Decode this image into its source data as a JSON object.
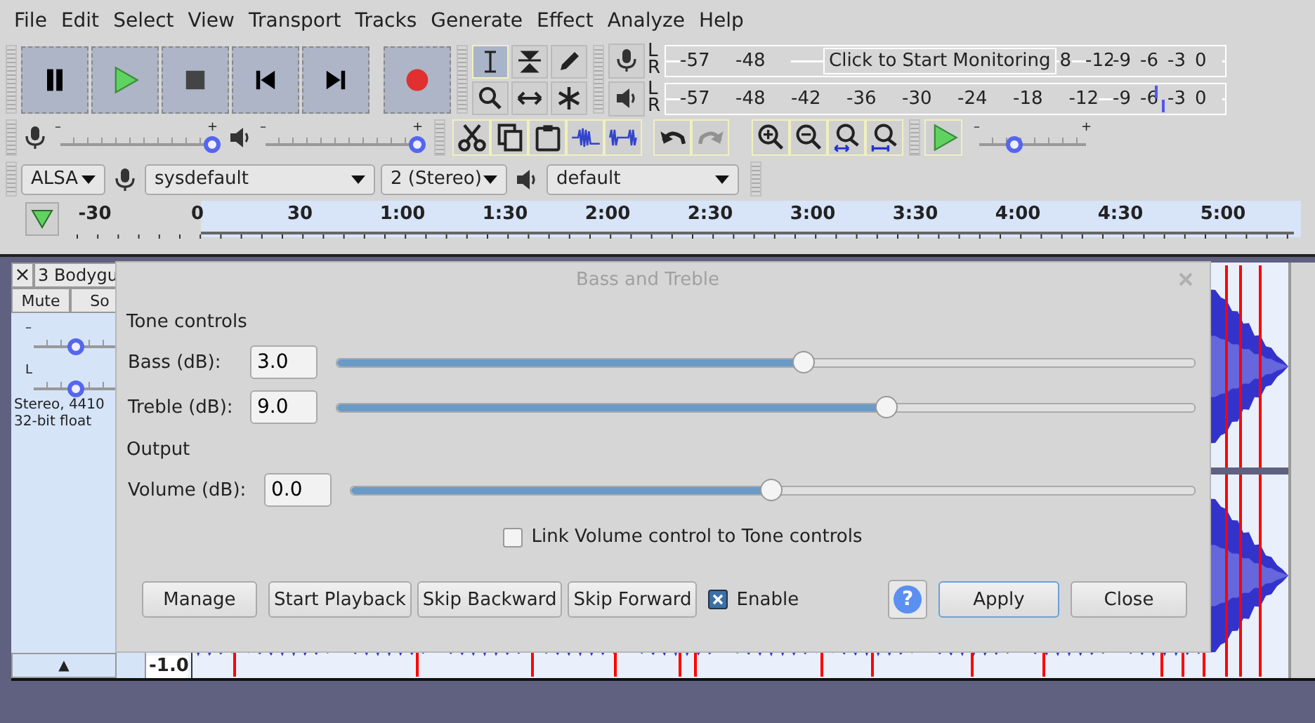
{
  "menu": [
    "File",
    "Edit",
    "Select",
    "View",
    "Transport",
    "Tracks",
    "Generate",
    "Effect",
    "Analyze",
    "Help"
  ],
  "transport": [
    {
      "kind": "pause"
    },
    {
      "kind": "play"
    },
    {
      "kind": "stop"
    },
    {
      "kind": "skip-start"
    },
    {
      "kind": "skip-end"
    },
    {
      "kind": "record"
    }
  ],
  "tools": [
    {
      "kind": "ibeam",
      "selected": true
    },
    {
      "kind": "envelope",
      "selected": false
    },
    {
      "kind": "pencil",
      "selected": false
    },
    {
      "kind": "zoom",
      "selected": false
    },
    {
      "kind": "timeshift",
      "selected": false
    },
    {
      "kind": "multi",
      "selected": false
    }
  ],
  "meters": [
    {
      "kind": "record",
      "channels": [
        "L",
        "R"
      ],
      "scale_low": [
        "-57",
        "-48"
      ],
      "scale_high": [
        "8",
        "-12",
        "-9",
        "-6",
        "-3",
        "0"
      ],
      "tooltip": "Click to Start Monitoring"
    },
    {
      "kind": "playback",
      "channels": [
        "L",
        "R"
      ],
      "scale_low": [
        "-57",
        "-48",
        "-42",
        "-36",
        "-30",
        "-24",
        "-18"
      ],
      "scale_high": [
        "-12",
        "-9",
        "-6",
        "-3",
        "0"
      ],
      "peaks": [
        {
          "level": 0.875
        },
        {
          "level": 0.888
        }
      ]
    }
  ],
  "mixer": [
    {
      "kind": "record",
      "minus": "–",
      "plus": "+",
      "level": 1.0
    },
    {
      "kind": "playback",
      "minus": "–",
      "plus": "+",
      "level": 1.0
    }
  ],
  "edit_tools": [
    {
      "kind": "scissors"
    },
    {
      "kind": "copy"
    },
    {
      "kind": "paste"
    },
    {
      "kind": "trim"
    },
    {
      "kind": "silence"
    }
  ],
  "history": [
    {
      "kind": "undo",
      "disabled": false
    },
    {
      "kind": "redo",
      "disabled": true
    }
  ],
  "zoom_tools": [
    {
      "kind": "zoom-in"
    },
    {
      "kind": "zoom-out"
    },
    {
      "kind": "fit-selection"
    },
    {
      "kind": "fit-project"
    }
  ],
  "play_at_speed": {
    "minus": "–",
    "plus": "+",
    "level": 0.33
  },
  "devices": {
    "host": "ALSA",
    "input": "sysdefault",
    "channels": "2 (Stereo)",
    "output": "default"
  },
  "timeline": [
    "-30",
    "0",
    "30",
    "1:00",
    "1:30",
    "2:00",
    "2:30",
    "3:00",
    "3:30",
    "4:00",
    "4:30",
    "5:00"
  ],
  "track": {
    "close": "×",
    "name": "3 Bodygu",
    "buttons": [
      "Mute",
      "So"
    ],
    "slider_labels": [
      "–",
      "L"
    ],
    "info": [
      "Stereo, 4410",
      "32-bit float"
    ],
    "collapse": "▲",
    "scale": "-1.0"
  },
  "dialog": {
    "title": "Bass and Treble",
    "sections": [
      {
        "heading": "Tone controls",
        "rows": [
          {
            "label": "Bass (dB):",
            "value": "3.0",
            "level": 0.546
          },
          {
            "label": "Treble (dB):",
            "value": "9.0",
            "level": 0.644
          }
        ]
      },
      {
        "heading": "Output",
        "rows": [
          {
            "label": "Volume (dB):",
            "value": "0.0",
            "level": 0.498
          }
        ]
      }
    ],
    "link": {
      "label": "Link Volume control to Tone controls",
      "checked": false
    },
    "buttons": [
      "Manage",
      "Start Playback",
      "Skip Backward",
      "Skip Forward"
    ],
    "enable": {
      "label": "Enable",
      "checked": true
    },
    "help": "?",
    "actions": [
      "Apply",
      "Close"
    ]
  }
}
